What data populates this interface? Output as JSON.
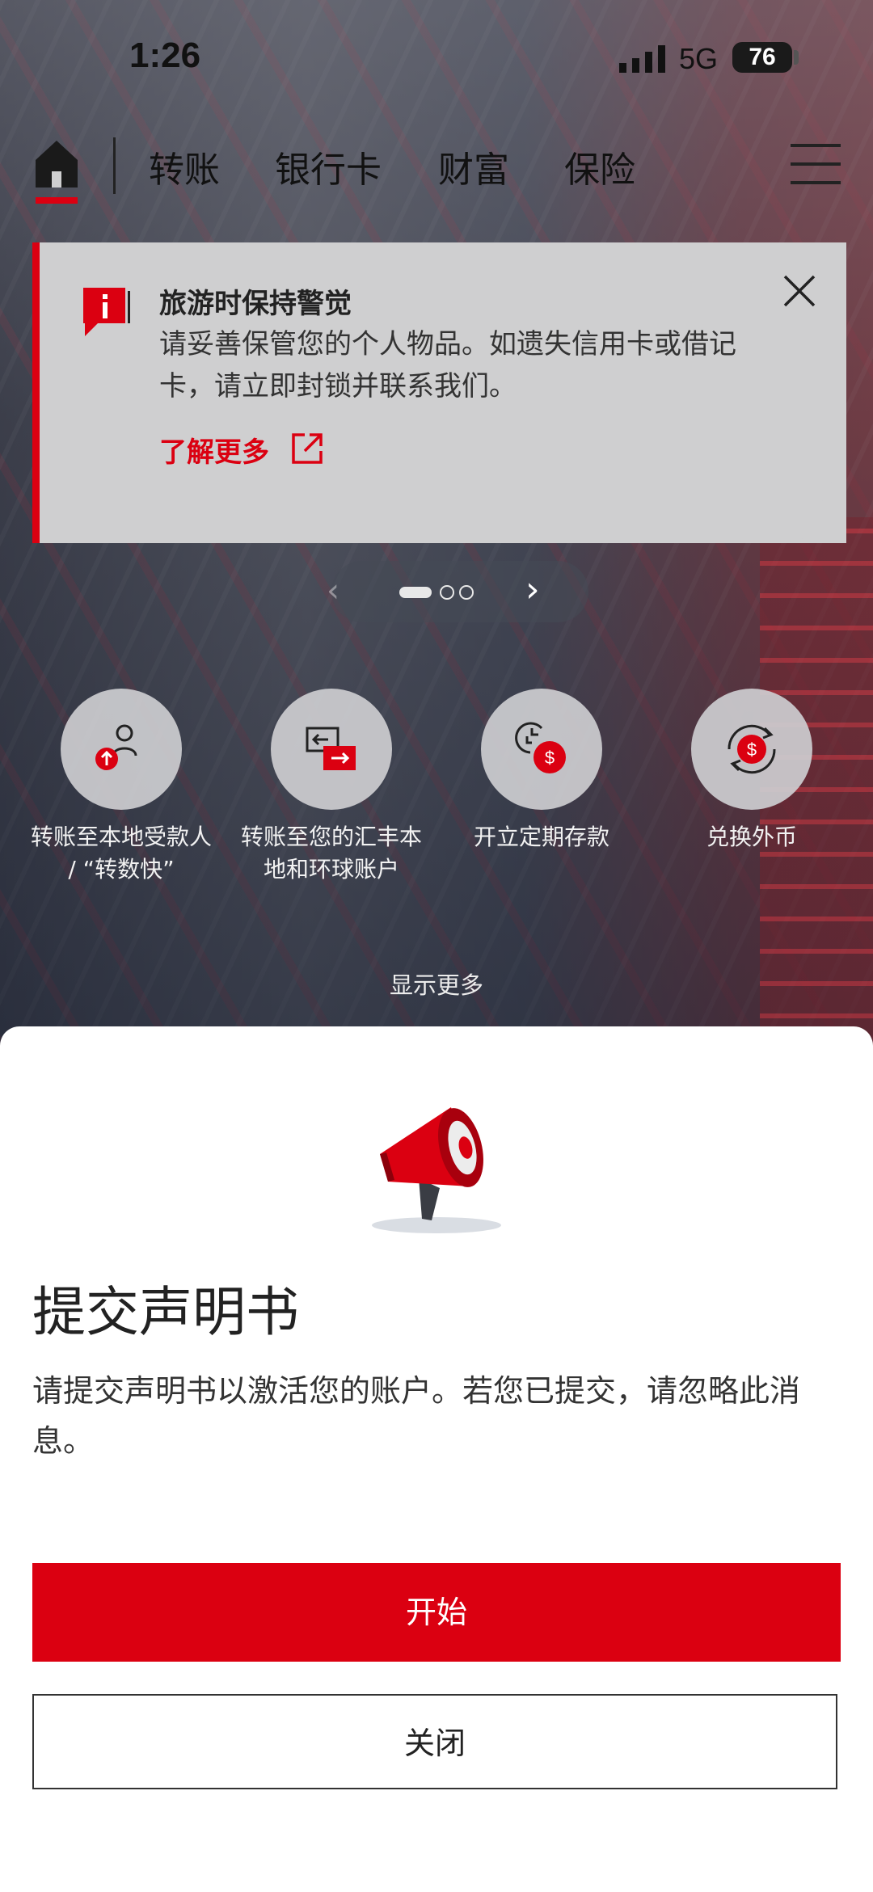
{
  "status_bar": {
    "time": "1:26",
    "network": "5G",
    "battery": "76"
  },
  "nav": {
    "items": [
      "转账",
      "银行卡",
      "财富",
      "保险"
    ]
  },
  "alert": {
    "title": "旅游时保持警觉",
    "body": "请妥善保管您的个人物品。如遗失信用卡或借记卡，请立即封锁并联系我们。",
    "link": "了解更多"
  },
  "quick_actions": [
    {
      "label": "转账至本地受款人 / “转数快”",
      "icon": "person-upload-icon"
    },
    {
      "label": "转账至您的汇丰本地和环球账户",
      "icon": "account-transfer-icon"
    },
    {
      "label": "开立定期存款",
      "icon": "time-deposit-icon"
    },
    {
      "label": "兑换外币",
      "icon": "currency-exchange-icon"
    }
  ],
  "show_more": "显示更多",
  "sheet": {
    "title": "提交声明书",
    "text": "请提交声明书以激活您的账户。若您已提交，请忽略此消息。",
    "primary_button": "开始",
    "secondary_button": "关闭"
  },
  "colors": {
    "brand_red": "#db0011",
    "alert_bg": "#cfcfd0"
  }
}
